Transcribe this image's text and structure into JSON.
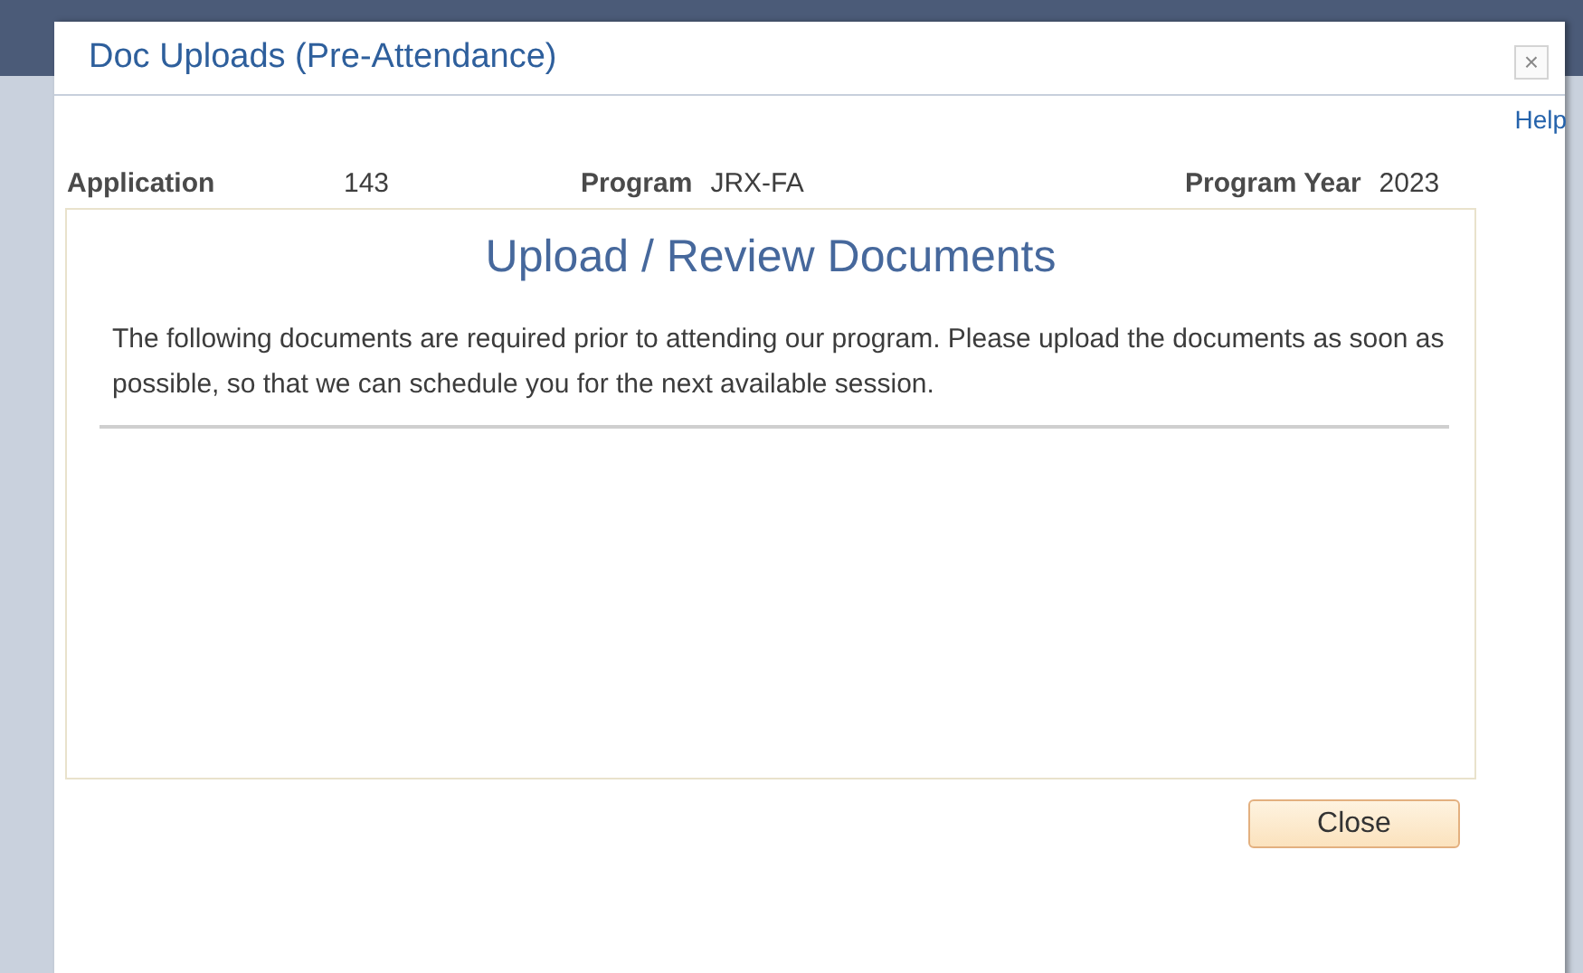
{
  "window": {
    "title": "Doc Uploads (Pre-Attendance)",
    "close_icon": "×"
  },
  "help_link": "Help",
  "info": [
    {
      "label": "Application",
      "value": "143"
    },
    {
      "label": "Program",
      "value": "JRX-FA"
    },
    {
      "label": "Program Year",
      "value": "2023"
    }
  ],
  "panel": {
    "heading": "Upload / Review Documents",
    "text": "The following documents are required prior to attending our program.  Please upload the documents as soon as possible, so that we can schedule you for the next available session."
  },
  "buttons": [
    "Close"
  ]
}
